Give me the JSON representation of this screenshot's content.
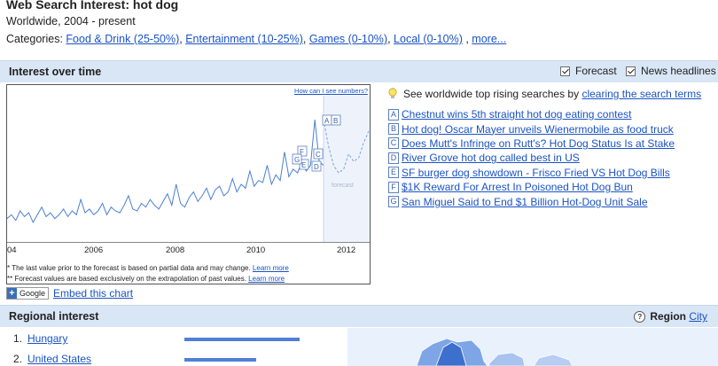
{
  "header": {
    "title": "Web Search Interest: hot dog",
    "subtitle": "Worldwide, 2004 - present",
    "categories_label": "Categories:",
    "categories": [
      "Food & Drink (25-50%)",
      "Entertainment (10-25%)",
      "Games (0-10%)",
      "Local (0-10%)"
    ],
    "more": "more..."
  },
  "interest_bar": {
    "title": "Interest over time",
    "forecast_label": "Forecast",
    "news_label": "News headlines"
  },
  "chart": {
    "how_link": "How can I see numbers?",
    "x_ticks": [
      "04",
      "2006",
      "2008",
      "2010",
      "2012"
    ],
    "forecast_text": "forecast",
    "note1": "* The last value prior to the forecast is based on partial data and may change.",
    "note2": "** Forecast values are based exclusively on the extrapolation of past values.",
    "learn_more": "Learn more",
    "markers": [
      "A",
      "B",
      "C",
      "D",
      "E",
      "F",
      "G"
    ],
    "line_color": "#4a7fd4",
    "forecast_color": "#7aa3e2"
  },
  "chart_data": {
    "type": "line",
    "xlabel": "",
    "ylabel": "",
    "x_range": [
      2004,
      2012.6
    ],
    "series": [
      {
        "values": [
          10,
          12,
          9,
          14,
          11,
          13,
          8,
          12,
          16,
          11,
          13,
          10,
          12,
          15,
          11,
          14,
          12,
          20,
          13,
          15,
          12,
          14,
          18,
          12,
          16,
          14,
          13,
          17,
          22,
          15,
          14,
          18,
          16,
          20,
          17,
          15,
          19,
          23,
          17,
          28,
          18,
          16,
          21,
          24,
          19,
          22,
          26,
          20,
          25,
          27,
          22,
          24,
          31,
          24,
          28,
          26,
          35,
          27,
          30,
          29,
          38,
          28,
          33,
          30,
          45,
          32,
          36,
          34,
          40,
          35,
          38,
          62,
          40,
          38
        ]
      },
      {
        "values": [
          62,
          48,
          38,
          34,
          36,
          44,
          40,
          42,
          50,
          56
        ]
      }
    ]
  },
  "embed": {
    "google_label": "Google",
    "embed_link": "Embed this chart"
  },
  "rising": {
    "prefix": "See worldwide top rising searches by",
    "link": "clearing the search terms"
  },
  "news": [
    {
      "letter": "A",
      "text": "Chestnut wins 5th straight hot dog eating contest"
    },
    {
      "letter": "B",
      "text": "Hot dog! Oscar Mayer unveils Wienermobile as food truck"
    },
    {
      "letter": "C",
      "text": "Does Mutt's Infringe on Rutt's? Hot Dog Status Is at Stake"
    },
    {
      "letter": "D",
      "text": "River Grove hot dog called best in US"
    },
    {
      "letter": "E",
      "text": "SF burger dog showdown - Frisco Fried VS Hot Dog Bills"
    },
    {
      "letter": "F",
      "text": "$1K Reward For Arrest In Poisoned Hot Dog Bun"
    },
    {
      "letter": "G",
      "text": "San Miguel Said to End $1 Billion Hot-Dog Unit Sale"
    }
  ],
  "regional": {
    "title": "Regional interest",
    "region_label": "Region",
    "city_link": "City",
    "rows": [
      {
        "num": "1.",
        "name": "Hungary",
        "level": 1.0
      },
      {
        "num": "2.",
        "name": "United States",
        "level": 0.62
      }
    ]
  }
}
